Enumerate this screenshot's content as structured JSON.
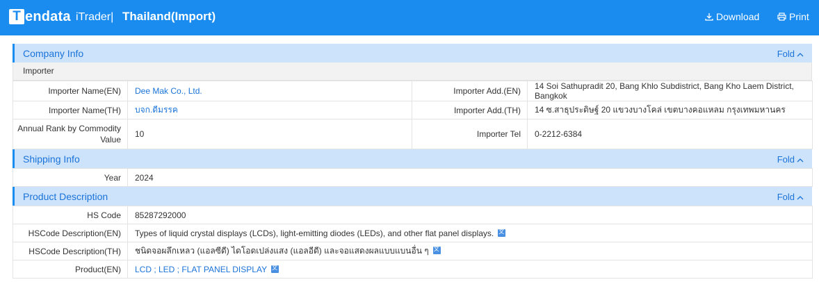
{
  "header": {
    "logo_text": "endata",
    "logo_letter": "T",
    "product": "iTrader|",
    "title": "Thailand(Import)",
    "download_label": "Download",
    "print_label": "Print"
  },
  "fold_label": "Fold",
  "company_info": {
    "title": "Company Info",
    "subhead": "Importer",
    "rows": [
      {
        "label1": "Importer Name(EN)",
        "value1": "Dee Mak Co., Ltd.",
        "label2": "Importer Add.(EN)",
        "value2": "14 Soi Sathupradit 20, Bang Khlo Subdistrict, Bang Kho Laem District, Bangkok"
      },
      {
        "label1": "Importer Name(TH)",
        "value1": "บจก.ดีมรรค",
        "label2": "Importer Add.(TH)",
        "value2": "14 ซ.สาธุประดิษฐ์ 20 แขวงบางโคล่ เขตบางคอแหลม กรุงเทพมหานคร"
      },
      {
        "label1": "Annual Rank by Commodity Value",
        "value1": "10",
        "label2": "Importer Tel",
        "value2": "0-2212-6384"
      }
    ]
  },
  "shipping_info": {
    "title": "Shipping Info",
    "year_label": "Year",
    "year_value": "2024"
  },
  "product_description": {
    "title": "Product Description",
    "hs_code_label": "HS Code",
    "hs_code_value": "85287292000",
    "hs_desc_en_label": "HSCode Description(EN)",
    "hs_desc_en_value": "Types of liquid crystal displays (LCDs), light-emitting diodes (LEDs), and other flat panel displays.",
    "hs_desc_th_label": "HSCode Description(TH)",
    "hs_desc_th_value": "ชนิดจอผลึกเหลว (แอลซีดี) ไดโอดเปล่งแสง (แอลอีดี) และจอแสดงผลแบบแบนอื่น ๆ",
    "product_en_label": "Product(EN)",
    "product_en_value": "LCD ; LED ; FLAT PANEL DISPLAY"
  }
}
